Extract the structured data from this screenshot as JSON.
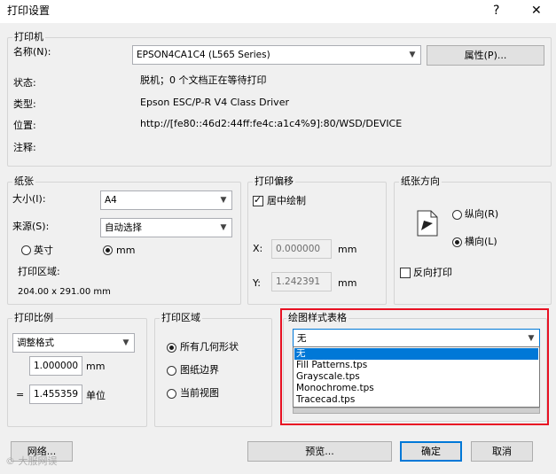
{
  "window": {
    "title": "打印设置",
    "help_glyph": "?",
    "close_glyph": "✕"
  },
  "printer": {
    "group_label": "打印机",
    "name_label": "名称(N):",
    "name_value": "EPSON4CA1C4 (L565 Series)",
    "properties_button": "属性(P)...",
    "status_label": "状态:",
    "status_value": "脱机；0 个文档正在等待打印",
    "type_label": "类型:",
    "type_value": "Epson ESC/P-R V4 Class Driver",
    "location_label": "位置:",
    "location_value": "http://[fe80::46d2:44ff:fe4c:a1c4%9]:80/WSD/DEVICE",
    "comment_label": "注释:"
  },
  "paper": {
    "group_label": "纸张",
    "size_label": "大小(I):",
    "size_value": "A4",
    "source_label": "来源(S):",
    "source_value": "自动选择",
    "unit_inch": "英寸",
    "unit_mm": "mm",
    "selected_unit": "mm",
    "area_label": "打印区域:",
    "area_value": "204.00 x 291.00 mm"
  },
  "offset": {
    "group_label": "打印偏移",
    "center_label": "居中绘制",
    "center_checked": true,
    "x_label": "X:",
    "x_value": "0.000000",
    "x_unit": "mm",
    "y_label": "Y:",
    "y_value": "1.242391",
    "y_unit": "mm"
  },
  "orientation": {
    "group_label": "纸张方向",
    "portrait_label": "纵向(R)",
    "landscape_label": "横向(L)",
    "selected": "landscape",
    "reverse_label": "反向打印",
    "reverse_checked": false
  },
  "scale": {
    "group_label": "打印比例",
    "mode_value": "调整格式",
    "value1": "1.000000",
    "unit1": "mm",
    "equals": "=",
    "value2": "1.455359",
    "unit2": "单位"
  },
  "print_area": {
    "group_label": "打印区域",
    "options": [
      "所有几何形状",
      "图纸边界",
      "当前视图"
    ],
    "selected_index": 0
  },
  "plot_style": {
    "group_label": "绘图样式表格",
    "selected_value": "无",
    "options": [
      "无",
      "Fill Patterns.tps",
      "Grayscale.tps",
      "Monochrome.tps",
      "Tracecad.tps"
    ],
    "highlighted_index": 0
  },
  "footer": {
    "network_button": "网络...",
    "preview_button": "预览...",
    "ok_button": "确定",
    "cancel_button": "取消",
    "watermark": "© 大服网误"
  },
  "colors": {
    "accent": "#0078d7",
    "highlight_frame": "#e81123"
  }
}
